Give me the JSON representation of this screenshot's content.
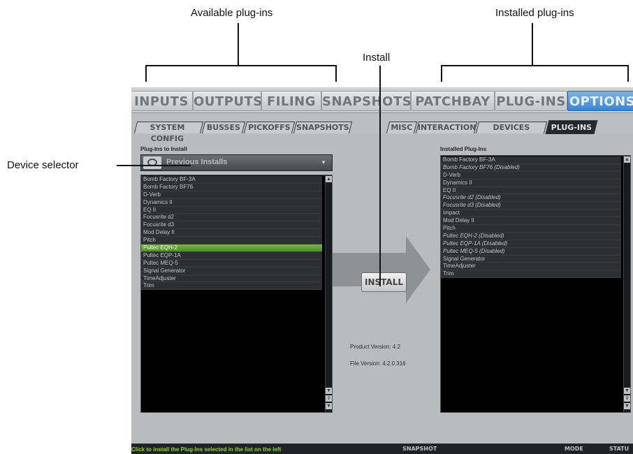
{
  "annotations": {
    "available": "Available plug-ins",
    "installed": "Installed plug-ins",
    "install": "Install",
    "device_selector": "Device selector"
  },
  "main_tabs": [
    "INPUTS",
    "OUTPUTS",
    "FILING",
    "SNAPSHOTS",
    "PATCHBAY",
    "PLUG-INS",
    "OPTIONS"
  ],
  "active_main_tab": "OPTIONS",
  "sub_tabs": [
    "SYSTEM CONFIG",
    "BUSSES",
    "PICKOFFS",
    "SNAPSHOTS",
    "MISC",
    "INTERACTION",
    "DEVICES",
    "PLUG-INS"
  ],
  "active_sub_tab": "PLUG-INS",
  "left_panel": {
    "title": "Plug-Ins to Install",
    "device_selector_value": "Previous Installs",
    "items": [
      "Bomb Factory BF-3A",
      "Bomb Factory BF76",
      "D-Verb",
      "Dynamics II",
      "EQ II",
      "Focusrite d2",
      "Focusrite d3",
      "Mod Delay II",
      "Pitch",
      "Pultec EQH-2",
      "Pultec EQP-1A",
      "Pultec MEQ-5",
      "Signal Generator",
      "TimeAdjuster",
      "Trim"
    ],
    "selected_item": "Pultec EQH-2"
  },
  "install_button": "INSTALL",
  "product_version": "Product Version: 4.2",
  "file_version": "File Version: 4.2.0.316",
  "right_panel": {
    "title": "Installed Plug-Ins",
    "items": [
      "Bomb Factory BF-3A",
      "Bomb Factory BF76 (Disabled)",
      "D-Verb",
      "Dynamics II",
      "EQ II",
      "Focusrite d2 (Disabled)",
      "Focusrite d3 (Disabled)",
      "Impact",
      "Mod Delay II",
      "Pitch",
      "Pultec EQH-2 (Disabled)",
      "Pultec EQP-1A (Disabled)",
      "Pultec MEQ-5 (Disabled)",
      "Signal Generator",
      "TimeAdjuster",
      "Trim"
    ]
  },
  "status_bar": {
    "message": "Click to install the Plug-Ins selected in the list on the left",
    "snapshot_label": "SNAPSHOT",
    "mode_label": "MODE",
    "status_label": "STATU"
  }
}
